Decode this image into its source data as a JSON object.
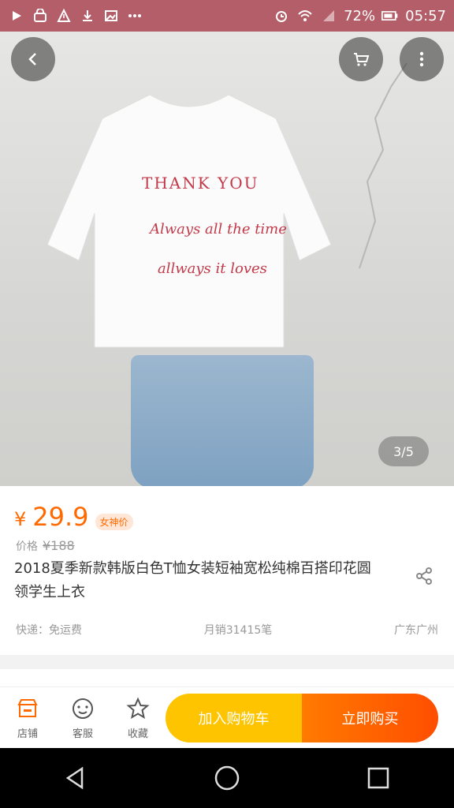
{
  "status": {
    "battery": "72%",
    "time": "05:57"
  },
  "hero": {
    "image_counter": "3/5",
    "shirt_line1": "THANK YOU",
    "shirt_line2": "Always all the time",
    "shirt_line3": "allways it loves"
  },
  "product": {
    "currency": "¥",
    "price": "29.9",
    "badge": "女神价",
    "original_label": "价格",
    "original_price": "¥188",
    "title": "2018夏季新款韩版白色T恤女装短袖宽松纯棉百搭印花圆领学生上衣",
    "shipping": "快递：免运费",
    "sales": "月销31415笔",
    "location": "广东广州"
  },
  "bottom_bar": {
    "shop": "店铺",
    "service": "客服",
    "favorite": "收藏",
    "add_to_cart": "加入购物车",
    "buy_now": "立即购买"
  },
  "colors": {
    "status_bar": "#b45e69",
    "price": "#ff6a00",
    "cart_button": "#ffc400",
    "buy_button": "#ff5a00"
  },
  "icons": {
    "back": "chevron-left-icon",
    "cart": "cart-icon",
    "more": "more-vertical-icon",
    "share": "share-icon",
    "shop": "shop-icon",
    "service": "service-icon",
    "favorite": "star-icon"
  }
}
